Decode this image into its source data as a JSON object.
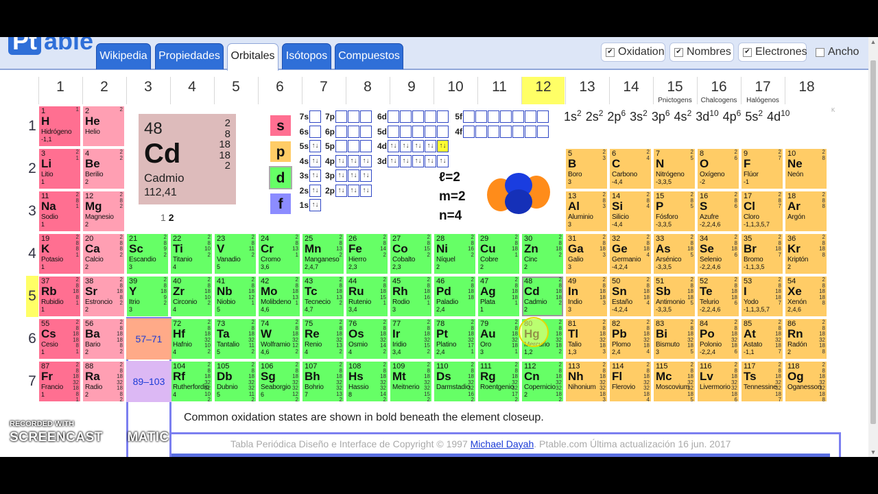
{
  "logo": {
    "pt": "Pt",
    "able": "able"
  },
  "tabs": [
    {
      "label": "Wikipedia"
    },
    {
      "label": "Propiedades"
    },
    {
      "label": "Orbitales"
    },
    {
      "label": "Isótopos"
    },
    {
      "label": "Compuestos"
    }
  ],
  "options": [
    {
      "label": "Oxidation",
      "checked": "✔"
    },
    {
      "label": "Nombres",
      "checked": "✔"
    },
    {
      "label": "Electrones",
      "checked": "✔"
    },
    {
      "label": "Ancho",
      "checked": ""
    }
  ],
  "groups": [
    {
      "n": "1",
      "name": ""
    },
    {
      "n": "2",
      "name": ""
    },
    {
      "n": "3",
      "name": ""
    },
    {
      "n": "4",
      "name": ""
    },
    {
      "n": "5",
      "name": ""
    },
    {
      "n": "6",
      "name": ""
    },
    {
      "n": "7",
      "name": ""
    },
    {
      "n": "8",
      "name": ""
    },
    {
      "n": "9",
      "name": ""
    },
    {
      "n": "10",
      "name": ""
    },
    {
      "n": "11",
      "name": ""
    },
    {
      "n": "12",
      "name": ""
    },
    {
      "n": "13",
      "name": ""
    },
    {
      "n": "14",
      "name": ""
    },
    {
      "n": "15",
      "name": "Pnictogens"
    },
    {
      "n": "16",
      "name": "Chalcogens"
    },
    {
      "n": "17",
      "name": "Halógenos"
    },
    {
      "n": "18",
      "name": ""
    }
  ],
  "periods": [
    "1",
    "2",
    "3",
    "4",
    "5",
    "6",
    "7"
  ],
  "focus": {
    "number": "48",
    "symbol": "Cd",
    "name": "Cadmio",
    "mass": "112,41",
    "shells": [
      "2",
      "8",
      "18",
      "18",
      "2"
    ],
    "ox_prefix": "1 ",
    "ox_bold": "2"
  },
  "blocks": [
    "s",
    "p",
    "d",
    "f"
  ],
  "config": [
    "1s",
    "2",
    "2s",
    "2",
    "2p",
    "6",
    "3s",
    "2",
    "3p",
    "6",
    "4s",
    "2",
    "3d",
    "10",
    "4p",
    "6",
    "5s",
    "2",
    "4d",
    "10"
  ],
  "quantum": [
    {
      "sym": "ℓ",
      "val": "=2"
    },
    {
      "sym": "m",
      "val": "=2"
    },
    {
      "sym": "n",
      "val": "=4"
    }
  ],
  "orbitals": {
    "s": [
      {
        "lbl": "7s",
        "fill": [
          ""
        ]
      },
      {
        "lbl": "6s",
        "fill": [
          ""
        ]
      },
      {
        "lbl": "5s",
        "fill": [
          "↑↓"
        ]
      },
      {
        "lbl": "4s",
        "fill": [
          "↑↓"
        ]
      },
      {
        "lbl": "3s",
        "fill": [
          "↑↓"
        ]
      },
      {
        "lbl": "2s",
        "fill": [
          "↑↓"
        ]
      },
      {
        "lbl": "1s",
        "fill": [
          "↑↓"
        ]
      }
    ],
    "p": [
      {
        "lbl": "7p",
        "fill": [
          "",
          "",
          ""
        ]
      },
      {
        "lbl": "6p",
        "fill": [
          "",
          "",
          ""
        ]
      },
      {
        "lbl": "5p",
        "fill": [
          "",
          "",
          ""
        ]
      },
      {
        "lbl": "4p",
        "fill": [
          "↑↓",
          "↑↓",
          "↑↓"
        ]
      },
      {
        "lbl": "3p",
        "fill": [
          "↑↓",
          "↑↓",
          "↑↓"
        ]
      },
      {
        "lbl": "2p",
        "fill": [
          "↑↓",
          "↑↓",
          "↑↓"
        ]
      }
    ],
    "d": [
      {
        "lbl": "6d",
        "fill": [
          "",
          "",
          "",
          "",
          ""
        ]
      },
      {
        "lbl": "5d",
        "fill": [
          "",
          "",
          "",
          "",
          ""
        ]
      },
      {
        "lbl": "4d",
        "fill": [
          "↑↓",
          "↑↓",
          "↑↓",
          "↑↓",
          "↑↓"
        ]
      },
      {
        "lbl": "3d",
        "fill": [
          "↑↓",
          "↑↓",
          "↑↓",
          "↑↓",
          "↑↓"
        ]
      }
    ],
    "f": [
      {
        "lbl": "5f",
        "fill": [
          "",
          "",
          "",
          "",
          "",
          "",
          ""
        ]
      },
      {
        "lbl": "4f",
        "fill": [
          "",
          "",
          "",
          "",
          "",
          "",
          ""
        ]
      }
    ]
  },
  "elements": [
    {
      "n": "1",
      "s": "H",
      "nm": "Hidrógeno",
      "ox": "-1,1",
      "sh": "1",
      "g": 1,
      "p": 1,
      "c": "al"
    },
    {
      "n": "2",
      "s": "He",
      "nm": "Helio",
      "ox": "",
      "sh": "2",
      "g": 2,
      "p": 1,
      "c": "ae"
    },
    {
      "n": "3",
      "s": "Li",
      "nm": "Litio",
      "ox": "1",
      "sh": "2 1",
      "g": 1,
      "p": 2,
      "c": "al"
    },
    {
      "n": "4",
      "s": "Be",
      "nm": "Berilio",
      "ox": "2",
      "sh": "2 2",
      "g": 2,
      "p": 2,
      "c": "ae"
    },
    {
      "n": "11",
      "s": "Na",
      "nm": "Sodio",
      "ox": "1",
      "sh": "2 8 1",
      "g": 1,
      "p": 3,
      "c": "al"
    },
    {
      "n": "12",
      "s": "Mg",
      "nm": "Magnesio",
      "ox": "2",
      "sh": "2 8 2",
      "g": 2,
      "p": 3,
      "c": "ae"
    },
    {
      "n": "19",
      "s": "K",
      "nm": "Potasio",
      "ox": "1",
      "sh": "2 8 8 1",
      "g": 1,
      "p": 4,
      "c": "al"
    },
    {
      "n": "20",
      "s": "Ca",
      "nm": "Calcio",
      "ox": "2",
      "sh": "2 8 8 2",
      "g": 2,
      "p": 4,
      "c": "ae"
    },
    {
      "n": "21",
      "s": "Sc",
      "nm": "Escandio",
      "ox": "3",
      "sh": "2 8 9 2",
      "g": 3,
      "p": 4,
      "c": "tm"
    },
    {
      "n": "22",
      "s": "Ti",
      "nm": "Titanio",
      "ox": "4",
      "sh": "2 8 10 2",
      "g": 4,
      "p": 4,
      "c": "tm"
    },
    {
      "n": "23",
      "s": "V",
      "nm": "Vanadio",
      "ox": "5",
      "sh": "2 8 11 2",
      "g": 5,
      "p": 4,
      "c": "tm"
    },
    {
      "n": "24",
      "s": "Cr",
      "nm": "Cromo",
      "ox": "3,6",
      "sh": "2 8 13 1",
      "g": 6,
      "p": 4,
      "c": "tm"
    },
    {
      "n": "25",
      "s": "Mn",
      "nm": "Manganeso",
      "ox": "2,4,7",
      "sh": "2 8 13 2",
      "g": 7,
      "p": 4,
      "c": "tm"
    },
    {
      "n": "26",
      "s": "Fe",
      "nm": "Hierro",
      "ox": "2,3",
      "sh": "2 8 14 2",
      "g": 8,
      "p": 4,
      "c": "tm"
    },
    {
      "n": "27",
      "s": "Co",
      "nm": "Cobalto",
      "ox": "2,3",
      "sh": "2 8 15 2",
      "g": 9,
      "p": 4,
      "c": "tm"
    },
    {
      "n": "28",
      "s": "Ni",
      "nm": "Níquel",
      "ox": "2",
      "sh": "2 8 16 2",
      "g": 10,
      "p": 4,
      "c": "tm"
    },
    {
      "n": "29",
      "s": "Cu",
      "nm": "Cobre",
      "ox": "2",
      "sh": "2 8 18 1",
      "g": 11,
      "p": 4,
      "c": "tm"
    },
    {
      "n": "30",
      "s": "Zn",
      "nm": "Cinc",
      "ox": "2",
      "sh": "2 8 18 2",
      "g": 12,
      "p": 4,
      "c": "tm"
    },
    {
      "n": "31",
      "s": "Ga",
      "nm": "Galio",
      "ox": "3",
      "sh": "2 8 18 3",
      "g": 13,
      "p": 4,
      "c": "ot"
    },
    {
      "n": "32",
      "s": "Ge",
      "nm": "Germanio",
      "ox": "-4,2,4",
      "sh": "2 8 18 4",
      "g": 14,
      "p": 4,
      "c": "ot"
    },
    {
      "n": "33",
      "s": "As",
      "nm": "Arsénico",
      "ox": "-3,3,5",
      "sh": "2 8 18 5",
      "g": 15,
      "p": 4,
      "c": "ot"
    },
    {
      "n": "34",
      "s": "Se",
      "nm": "Selenio",
      "ox": "-2,2,4,6",
      "sh": "2 8 18 6",
      "g": 16,
      "p": 4,
      "c": "ot"
    },
    {
      "n": "35",
      "s": "Br",
      "nm": "Bromo",
      "ox": "-1,1,3,5",
      "sh": "2 8 18 7",
      "g": 17,
      "p": 4,
      "c": "ot"
    },
    {
      "n": "36",
      "s": "Kr",
      "nm": "Kriptón",
      "ox": "2",
      "sh": "2 8 18 8",
      "g": 18,
      "p": 4,
      "c": "ot"
    },
    {
      "n": "5",
      "s": "B",
      "nm": "Boro",
      "ox": "3",
      "sh": "2 3",
      "g": 13,
      "p": 2,
      "c": "ot"
    },
    {
      "n": "6",
      "s": "C",
      "nm": "Carbono",
      "ox": "-4,4",
      "sh": "2 4",
      "g": 14,
      "p": 2,
      "c": "ot"
    },
    {
      "n": "7",
      "s": "N",
      "nm": "Nitrógeno",
      "ox": "-3,3,5",
      "sh": "2 5",
      "g": 15,
      "p": 2,
      "c": "ot"
    },
    {
      "n": "8",
      "s": "O",
      "nm": "Oxígeno",
      "ox": "-2",
      "sh": "2 6",
      "g": 16,
      "p": 2,
      "c": "ot"
    },
    {
      "n": "9",
      "s": "F",
      "nm": "Flúor",
      "ox": "-1",
      "sh": "2 7",
      "g": 17,
      "p": 2,
      "c": "ot"
    },
    {
      "n": "10",
      "s": "Ne",
      "nm": "Neón",
      "ox": "",
      "sh": "2 8",
      "g": 18,
      "p": 2,
      "c": "ot"
    },
    {
      "n": "13",
      "s": "Al",
      "nm": "Aluminio",
      "ox": "3",
      "sh": "2 8 3",
      "g": 13,
      "p": 3,
      "c": "ot"
    },
    {
      "n": "14",
      "s": "Si",
      "nm": "Silicio",
      "ox": "-4,4",
      "sh": "2 8 4",
      "g": 14,
      "p": 3,
      "c": "ot"
    },
    {
      "n": "15",
      "s": "P",
      "nm": "Fósforo",
      "ox": "-3,3,5",
      "sh": "2 8 5",
      "g": 15,
      "p": 3,
      "c": "ot"
    },
    {
      "n": "16",
      "s": "S",
      "nm": "Azufre",
      "ox": "-2,2,4,6",
      "sh": "2 8 6",
      "g": 16,
      "p": 3,
      "c": "ot"
    },
    {
      "n": "17",
      "s": "Cl",
      "nm": "Cloro",
      "ox": "-1,1,3,5,7",
      "sh": "2 8 7",
      "g": 17,
      "p": 3,
      "c": "ot"
    },
    {
      "n": "18",
      "s": "Ar",
      "nm": "Argón",
      "ox": "",
      "sh": "2 8 8",
      "g": 18,
      "p": 3,
      "c": "ot"
    },
    {
      "n": "37",
      "s": "Rb",
      "nm": "Rubidio",
      "ox": "1",
      "sh": "2 8 18 8 1",
      "g": 1,
      "p": 5,
      "c": "al"
    },
    {
      "n": "38",
      "s": "Sr",
      "nm": "Estroncio",
      "ox": "2",
      "sh": "2 8 18 8 2",
      "g": 2,
      "p": 5,
      "c": "ae"
    },
    {
      "n": "39",
      "s": "Y",
      "nm": "Itrio",
      "ox": "3",
      "sh": "2 8 18 9 2",
      "g": 3,
      "p": 5,
      "c": "tm"
    },
    {
      "n": "40",
      "s": "Zr",
      "nm": "Circonio",
      "ox": "4",
      "sh": "2 8 18 10 2",
      "g": 4,
      "p": 5,
      "c": "tm"
    },
    {
      "n": "41",
      "s": "Nb",
      "nm": "Niobio",
      "ox": "5",
      "sh": "2 8 18 12 1",
      "g": 5,
      "p": 5,
      "c": "tm"
    },
    {
      "n": "42",
      "s": "Mo",
      "nm": "Molibdeno",
      "ox": "4,6",
      "sh": "2 8 18 13 1",
      "g": 6,
      "p": 5,
      "c": "tm"
    },
    {
      "n": "43",
      "s": "Tc",
      "nm": "Tecnecio",
      "ox": "4,7",
      "sh": "2 8 18 13 2",
      "g": 7,
      "p": 5,
      "c": "tm"
    },
    {
      "n": "44",
      "s": "Ru",
      "nm": "Rutenio",
      "ox": "3,4",
      "sh": "2 8 18 15 1",
      "g": 8,
      "p": 5,
      "c": "tm"
    },
    {
      "n": "45",
      "s": "Rh",
      "nm": "Rodio",
      "ox": "3",
      "sh": "2 8 18 16 1",
      "g": 9,
      "p": 5,
      "c": "tm"
    },
    {
      "n": "46",
      "s": "Pd",
      "nm": "Paladio",
      "ox": "2,4",
      "sh": "2 8 18 18",
      "g": 10,
      "p": 5,
      "c": "tm"
    },
    {
      "n": "47",
      "s": "Ag",
      "nm": "Plata",
      "ox": "1",
      "sh": "2 8 18 18 1",
      "g": 11,
      "p": 5,
      "c": "tm"
    },
    {
      "n": "48",
      "s": "Cd",
      "nm": "Cadmio",
      "ox": "2",
      "sh": "2 8 18 18 2",
      "g": 12,
      "p": 5,
      "c": "tm",
      "hl": true
    },
    {
      "n": "49",
      "s": "In",
      "nm": "Indio",
      "ox": "3",
      "sh": "2 8 18 18 3",
      "g": 13,
      "p": 5,
      "c": "ot"
    },
    {
      "n": "50",
      "s": "Sn",
      "nm": "Estaño",
      "ox": "-4,2,4",
      "sh": "2 8 18 18 4",
      "g": 14,
      "p": 5,
      "c": "ot"
    },
    {
      "n": "51",
      "s": "Sb",
      "nm": "Antimonio",
      "ox": "-3,3,5",
      "sh": "2 8 18 18 5",
      "g": 15,
      "p": 5,
      "c": "ot"
    },
    {
      "n": "52",
      "s": "Te",
      "nm": "Telurio",
      "ox": "-2,2,4,6",
      "sh": "2 8 18 18 6",
      "g": 16,
      "p": 5,
      "c": "ot"
    },
    {
      "n": "53",
      "s": "I",
      "nm": "Yodo",
      "ox": "-1,1,3,5,7",
      "sh": "2 8 18 18 7",
      "g": 17,
      "p": 5,
      "c": "ot"
    },
    {
      "n": "54",
      "s": "Xe",
      "nm": "Xenón",
      "ox": "2,4,6",
      "sh": "2 8 18 18 8",
      "g": 18,
      "p": 5,
      "c": "ot"
    },
    {
      "n": "55",
      "s": "Cs",
      "nm": "Cesio",
      "ox": "1",
      "sh": "2 8 18 18 8 1",
      "g": 1,
      "p": 6,
      "c": "al"
    },
    {
      "n": "56",
      "s": "Ba",
      "nm": "Bario",
      "ox": "2",
      "sh": "2 8 18 18 8 2",
      "g": 2,
      "p": 6,
      "c": "ae"
    },
    {
      "n": "72",
      "s": "Hf",
      "nm": "Hafnio",
      "ox": "4",
      "sh": "2 8 18 32 10 2",
      "g": 4,
      "p": 6,
      "c": "tm"
    },
    {
      "n": "73",
      "s": "Ta",
      "nm": "Tantalio",
      "ox": "5",
      "sh": "2 8 18 32 11 2",
      "g": 5,
      "p": 6,
      "c": "tm"
    },
    {
      "n": "74",
      "s": "W",
      "nm": "Wolframio",
      "ox": "4,6",
      "sh": "2 8 18 32 12 2",
      "g": 6,
      "p": 6,
      "c": "tm"
    },
    {
      "n": "75",
      "s": "Re",
      "nm": "Renio",
      "ox": "4",
      "sh": "2 8 18 32 13 2",
      "g": 7,
      "p": 6,
      "c": "tm"
    },
    {
      "n": "76",
      "s": "Os",
      "nm": "Osmio",
      "ox": "4",
      "sh": "2 8 18 32 14 2",
      "g": 8,
      "p": 6,
      "c": "tm"
    },
    {
      "n": "77",
      "s": "Ir",
      "nm": "Iridio",
      "ox": "3,4",
      "sh": "2 8 18 32 15 2",
      "g": 9,
      "p": 6,
      "c": "tm"
    },
    {
      "n": "78",
      "s": "Pt",
      "nm": "Platino",
      "ox": "2,4",
      "sh": "2 8 18 32 17 1",
      "g": 10,
      "p": 6,
      "c": "tm"
    },
    {
      "n": "79",
      "s": "Au",
      "nm": "Oro",
      "ox": "3",
      "sh": "2 8 18 32 18 1",
      "g": 11,
      "p": 6,
      "c": "tm"
    },
    {
      "n": "80",
      "s": "Hg",
      "nm": "Mercurio",
      "ox": "1,2",
      "sh": "2 8 18 32 18 2",
      "g": 12,
      "p": 6,
      "c": "tm"
    },
    {
      "n": "81",
      "s": "Tl",
      "nm": "Talio",
      "ox": "1,3",
      "sh": "2 8 18 32 18 3",
      "g": 13,
      "p": 6,
      "c": "ot"
    },
    {
      "n": "82",
      "s": "Pb",
      "nm": "Plomo",
      "ox": "2,4",
      "sh": "2 8 18 32 18 4",
      "g": 14,
      "p": 6,
      "c": "ot"
    },
    {
      "n": "83",
      "s": "Bi",
      "nm": "Bismuto",
      "ox": "3",
      "sh": "2 8 18 32 18 5",
      "g": 15,
      "p": 6,
      "c": "ot"
    },
    {
      "n": "84",
      "s": "Po",
      "nm": "Polonio",
      "ox": "-2,2,4",
      "sh": "2 8 18 32 18 6",
      "g": 16,
      "p": 6,
      "c": "ot"
    },
    {
      "n": "85",
      "s": "At",
      "nm": "Astato",
      "ox": "-1,1",
      "sh": "2 8 18 32 18 7",
      "g": 17,
      "p": 6,
      "c": "ot"
    },
    {
      "n": "86",
      "s": "Rn",
      "nm": "Radón",
      "ox": "2",
      "sh": "2 8 18 32 18 8",
      "g": 18,
      "p": 6,
      "c": "ot"
    },
    {
      "n": "87",
      "s": "Fr",
      "nm": "Francio",
      "ox": "1",
      "sh": "2 8 18 32 18 8 1",
      "g": 1,
      "p": 7,
      "c": "al"
    },
    {
      "n": "88",
      "s": "Ra",
      "nm": "Radio",
      "ox": "2",
      "sh": "2 8 18 32 18 8 2",
      "g": 2,
      "p": 7,
      "c": "ae"
    },
    {
      "n": "104",
      "s": "Rf",
      "nm": "Rutherfordio",
      "ox": "4",
      "sh": "2 8 18 32 32 10 2",
      "g": 4,
      "p": 7,
      "c": "tm"
    },
    {
      "n": "105",
      "s": "Db",
      "nm": "Dubnio",
      "ox": "5",
      "sh": "2 8 18 32 32 11 2",
      "g": 5,
      "p": 7,
      "c": "tm"
    },
    {
      "n": "106",
      "s": "Sg",
      "nm": "Seaborgio",
      "ox": "6",
      "sh": "2 8 18 32 32 12 2",
      "g": 6,
      "p": 7,
      "c": "tm"
    },
    {
      "n": "107",
      "s": "Bh",
      "nm": "Bohrio",
      "ox": "7",
      "sh": "2 8 18 32 32 13 2",
      "g": 7,
      "p": 7,
      "c": "tm"
    },
    {
      "n": "108",
      "s": "Hs",
      "nm": "Hassio",
      "ox": "8",
      "sh": "2 8 18 32 32 14 2",
      "g": 8,
      "p": 7,
      "c": "tm"
    },
    {
      "n": "109",
      "s": "Mt",
      "nm": "Meitnerio",
      "ox": "",
      "sh": "2 8 18 32 32 15 2",
      "g": 9,
      "p": 7,
      "c": "tm"
    },
    {
      "n": "110",
      "s": "Ds",
      "nm": "Darmstadio",
      "ox": "",
      "sh": "2 8 18 32 32 16 2",
      "g": 10,
      "p": 7,
      "c": "tm"
    },
    {
      "n": "111",
      "s": "Rg",
      "nm": "Roentgenio",
      "ox": "",
      "sh": "2 8 18 32 32 17 2",
      "g": 11,
      "p": 7,
      "c": "tm"
    },
    {
      "n": "112",
      "s": "Cn",
      "nm": "Copernicio",
      "ox": "2",
      "sh": "2 8 18 32 32 18 2",
      "g": 12,
      "p": 7,
      "c": "tm"
    },
    {
      "n": "113",
      "s": "Nh",
      "nm": "Nihonium",
      "ox": "",
      "sh": "2 8 18 32 32 18 3",
      "g": 13,
      "p": 7,
      "c": "ot"
    },
    {
      "n": "114",
      "s": "Fl",
      "nm": "Flerovio",
      "ox": "",
      "sh": "2 8 18 32 32 18 4",
      "g": 14,
      "p": 7,
      "c": "ot"
    },
    {
      "n": "115",
      "s": "Mc",
      "nm": "Moscovium",
      "ox": "",
      "sh": "2 8 18 32 32 18 5",
      "g": 15,
      "p": 7,
      "c": "ot"
    },
    {
      "n": "116",
      "s": "Lv",
      "nm": "Livermorio",
      "ox": "",
      "sh": "2 8 18 32 32 18 6",
      "g": 16,
      "p": 7,
      "c": "ot"
    },
    {
      "n": "117",
      "s": "Ts",
      "nm": "Tennessine",
      "ox": "",
      "sh": "2 8 18 32 32 18 7",
      "g": 17,
      "p": 7,
      "c": "ot"
    },
    {
      "n": "118",
      "s": "Og",
      "nm": "Oganesson",
      "ox": "",
      "sh": "2 8 18 32 32 18 8",
      "g": 18,
      "p": 7,
      "c": "ot"
    }
  ],
  "lanthanides": {
    "label": "57–71"
  },
  "actinides": {
    "label": "89–103"
  },
  "note": "Common oxidation states are shown in bold beneath the element closeup.",
  "footer": {
    "text": "Tabla Periódica Diseño e Interface de Copyright © 1997 ",
    "link": "Michael Dayah",
    "rest": ". Ptable.com Última actualización 16 jun. 2017"
  },
  "watermark": {
    "line1": "RECORDED WITH",
    "line2": "SCREENCAST",
    "line3": "MATIC"
  },
  "colors": {
    "alkali": "#ff6f91",
    "alkaline": "#ff9fb3",
    "transition": "#66ff66",
    "other": "#ffcc66",
    "highlight": "#ffff66",
    "brand": "#2f6fd8"
  }
}
